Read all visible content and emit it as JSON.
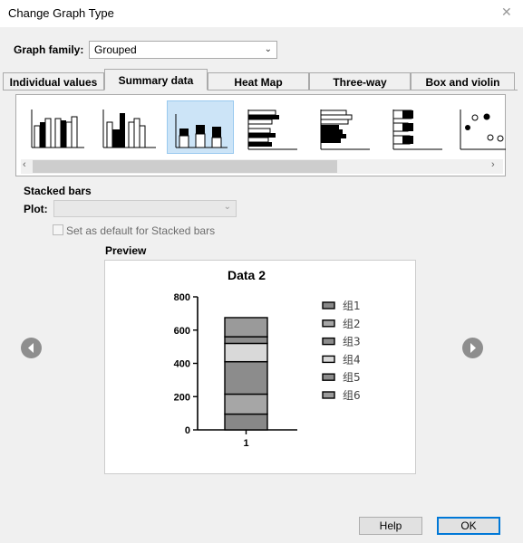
{
  "window": {
    "title": "Change Graph Type",
    "close_symbol": "✕"
  },
  "graph_family": {
    "label": "Graph family:",
    "value": "Grouped"
  },
  "tabs": [
    {
      "label": "Individual values",
      "active": false
    },
    {
      "label": "Summary data",
      "active": true
    },
    {
      "label": "Heat Map",
      "active": false
    },
    {
      "label": "Three-way",
      "active": false
    },
    {
      "label": "Box and violin",
      "active": false
    }
  ],
  "gallery": {
    "thumbnails": [
      "grouped-bars-icon",
      "grouped-bars-filled-icon",
      "stacked-bars-icon",
      "horizontal-grouped-bars-icon",
      "horizontal-stacked-bars-icon",
      "horizontal-bars-icon",
      "scatter-points-icon"
    ],
    "selected_index": 2,
    "scroll_left": "‹",
    "scroll_right": "›"
  },
  "section": {
    "heading": "Stacked bars",
    "plot_label": "Plot:",
    "plot_value": "",
    "default_checkbox_label": "Set as default for Stacked bars",
    "default_checked": false
  },
  "preview": {
    "label": "Preview",
    "nav_prev": "previous",
    "nav_next": "next"
  },
  "chart_data": {
    "type": "bar",
    "stacked": true,
    "title": "Data 2",
    "categories": [
      "1"
    ],
    "xlabel": "",
    "ylabel": "",
    "ylim": [
      0,
      800
    ],
    "yticks": [
      0,
      200,
      400,
      600,
      800
    ],
    "legend_position": "right",
    "series": [
      {
        "name": "组1",
        "values": [
          95
        ],
        "color": "#888888"
      },
      {
        "name": "组2",
        "values": [
          120
        ],
        "color": "#a6a6a6"
      },
      {
        "name": "组3",
        "values": [
          195
        ],
        "color": "#8c8c8c"
      },
      {
        "name": "组4",
        "values": [
          110
        ],
        "color": "#d9d9d9"
      },
      {
        "name": "组5",
        "values": [
          40
        ],
        "color": "#8c8c8c"
      },
      {
        "name": "组6",
        "values": [
          115
        ],
        "color": "#9a9a9a"
      }
    ]
  },
  "buttons": {
    "help": "Help",
    "ok": "OK"
  }
}
